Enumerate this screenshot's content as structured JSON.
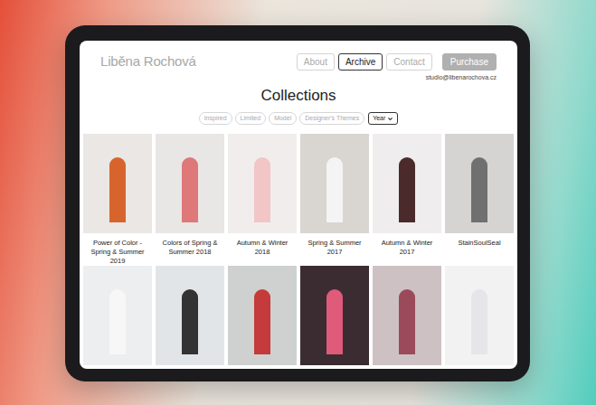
{
  "site": {
    "logo": "Liběna Rochová",
    "email": "studio@libenarochova.cz"
  },
  "nav": [
    {
      "label": "About",
      "selected": false
    },
    {
      "label": "Archive",
      "selected": true
    },
    {
      "label": "Contact",
      "selected": false
    }
  ],
  "purchase": "Purchase",
  "heading": "Collections",
  "filters": [
    {
      "label": "Inspired"
    },
    {
      "label": "Limited"
    },
    {
      "label": "Model"
    },
    {
      "label": "Designer's Themes"
    }
  ],
  "year": {
    "label": "Year"
  },
  "collections": [
    {
      "title": "Power of Color - Spring & Summer 2019"
    },
    {
      "title": "Colors of Spring & Summer 2018"
    },
    {
      "title": "Autumn & Winter 2018"
    },
    {
      "title": "Spring & Summer 2017"
    },
    {
      "title": "Autumn & Winter 2017"
    },
    {
      "title": "StainSoulSeal"
    },
    {},
    {},
    {},
    {},
    {},
    {}
  ]
}
